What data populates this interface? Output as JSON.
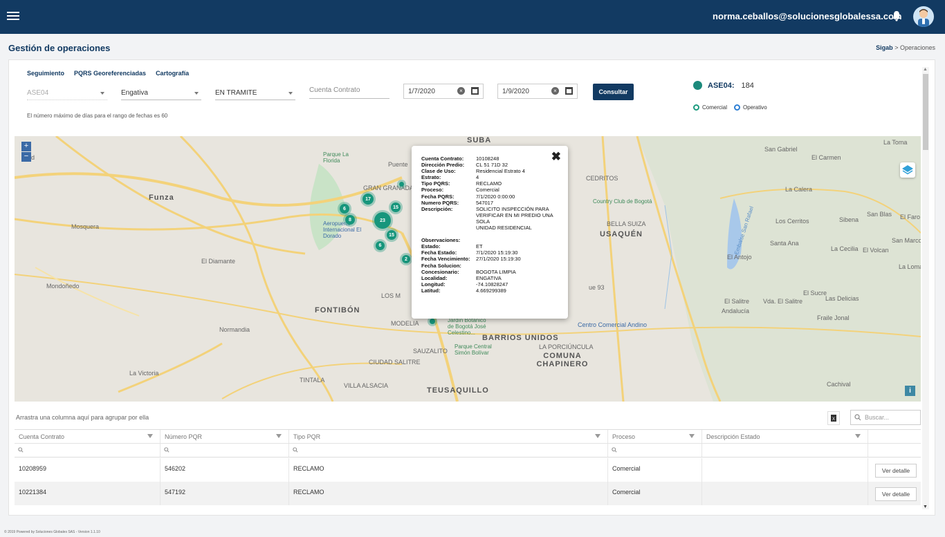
{
  "header": {
    "user_email": "norma.ceballos@solucionesglobalessa.com"
  },
  "page": {
    "title": "Gestión de operaciones",
    "breadcrumb_root": "Sigab",
    "breadcrumb_sep": ">",
    "breadcrumb_current": "Operaciones"
  },
  "tabs": [
    {
      "label": "Seguimiento"
    },
    {
      "label": "PQRS Georeferenciadas"
    },
    {
      "label": "Cartografía"
    }
  ],
  "filters": {
    "ase": "ASE04",
    "localidad": "Engativa",
    "estado": "EN TRAMITE",
    "cuenta_placeholder": "Cuenta Contrato",
    "fecha_desde": "1/7/2020",
    "fecha_hasta": "1/9/2020",
    "consultar_label": "Consultar",
    "hint": "El número máximo de días para el rango de fechas es 60"
  },
  "legend": {
    "label": "ASE04:",
    "count": "184",
    "radio_comercial": "Comercial",
    "radio_operativo": "Operativo",
    "colors": {
      "comercial": "#1c9b7f",
      "operativo": "#2d7fd4",
      "cluster": "#17967c"
    }
  },
  "map": {
    "places": {
      "suba": "SUBA",
      "funza": "Funza",
      "mosquera": "Mosquera",
      "madrid": "drid",
      "diamante": "El Diamante",
      "mondonedo": "Mondoñedo",
      "fontibon": "FONTIBÓN",
      "normandia": "Normandia",
      "la_victoria": "La Victoria",
      "tintala": "TINTALA",
      "alsacia": "VILLA ALSACIA",
      "teusaquillo": "TEUSAQUILLO",
      "chapinero": "COMUNA CHAPINERO",
      "barrios_unidos": "BARRIOS UNIDOS",
      "usaquen": "USAQUÉN",
      "cedritos": "CEDRITOS",
      "bella_suiza": "BELLA SUIZA",
      "country": "Country Club de Bogotá",
      "andino": "Centro Comercial Andino",
      "sauzalito": "SAUZALITO",
      "ciudad_salitre": "CIUDAD SALITRE",
      "modelia": "MODELIA",
      "gran_granada": "GRAN GRANADA",
      "aeropuerto": "Aeropuerto Internacional El Dorado",
      "parque_florida": "Parque La Florida",
      "simon_bolivar": "Parque Central Simón Bolívar",
      "botanico": "Jardín Botánico de Bogotá José Celestino...",
      "san_gabriel": "San Gabriel",
      "la_toma": "La Toma",
      "el_carmen": "El Carmen",
      "la_calera": "La Calera",
      "los_cerritos": "Los Cerritos",
      "sibena": "Sibena",
      "san_blas": "San Blas",
      "el_faro": "El Faro",
      "santa_ana": "Santa Ana",
      "la_cecilia": "La Cecilia",
      "el_volcan": "El Volcan",
      "san_marcos": "San Marcos",
      "el_antojo": "El Antojo",
      "la_loma": "La Loma",
      "el_salitre": "El Salitre",
      "vda_salitre": "Vda. El Salitre",
      "el_sucre": "El Sucre",
      "las_delicias": "Las Delicias",
      "andalucia": "Andalucía",
      "fraile_jonal": "Fraile Jonal",
      "cachival": "Cachival",
      "embalse": "Embalse San Rafael",
      "la_porciuncula": "LA PORCIÚNCULA",
      "los_m": "LOS M",
      "puente": "Puente",
      "ue93": "ue 93"
    },
    "clusters": [
      "17",
      "15",
      "6",
      "8",
      "23",
      "15",
      "6",
      "2"
    ],
    "popup": {
      "rows": [
        {
          "k": "Cuenta Contrato:",
          "v": "10108248"
        },
        {
          "k": "Dirección Predio:",
          "v": "CL 51 71D 32"
        },
        {
          "k": "Clase de Uso:",
          "v": "Residencial Estrato 4"
        },
        {
          "k": "Estrato:",
          "v": "4"
        },
        {
          "k": "Tipo PQRS:",
          "v": "RECLAMO"
        },
        {
          "k": "Proceso:",
          "v": "Comercial"
        },
        {
          "k": "Fecha PQRS:",
          "v": "7/1/2020 0:00:00"
        },
        {
          "k": "Numero PQRS:",
          "v": "547017"
        },
        {
          "k": "Descripción:",
          "v": "SOLICITO INSPECCIÓN PARA"
        },
        {
          "k": "",
          "v": "VERIFICAR EN MI PREDIO UNA SOLA"
        },
        {
          "k": "",
          "v": "UNIDAD RESIDENCIAL"
        },
        {
          "k": "",
          "v": ""
        },
        {
          "k": "Observaciones:",
          "v": ""
        },
        {
          "k": "Estado:",
          "v": "ET"
        },
        {
          "k": "Fecha Estado:",
          "v": "7/1/2020 15:19:30"
        },
        {
          "k": "Fecha Vencimiento:",
          "v": "27/1/2020 15:19:30"
        },
        {
          "k": "Fecha Solucion:",
          "v": ""
        },
        {
          "k": "Concesionario:",
          "v": "BOGOTA LIMPIA"
        },
        {
          "k": "Localidad:",
          "v": "ENGATIVA"
        },
        {
          "k": "Longitud:",
          "v": "-74.10828247"
        },
        {
          "k": "Latitud:",
          "v": "4.669299389"
        }
      ]
    }
  },
  "grid": {
    "group_hint": "Arrastra una columna aquí para agrupar por ella",
    "search_placeholder": "Buscar...",
    "columns": [
      "Cuenta Contrato",
      "Número PQR",
      "Tipo PQR",
      "Proceso",
      "Descripción Estado"
    ],
    "rows": [
      {
        "cuenta": "10208959",
        "numero": "546202",
        "tipo": "RECLAMO",
        "proceso": "Comercial",
        "descripcion": "",
        "action": "Ver detalle"
      },
      {
        "cuenta": "10221384",
        "numero": "547192",
        "tipo": "RECLAMO",
        "proceso": "Comercial",
        "descripcion": "",
        "action": "Ver detalle"
      }
    ]
  },
  "footer": {
    "text": "© 2019 Powered by Soluciones Globales SAS - Version 1.1.10"
  }
}
